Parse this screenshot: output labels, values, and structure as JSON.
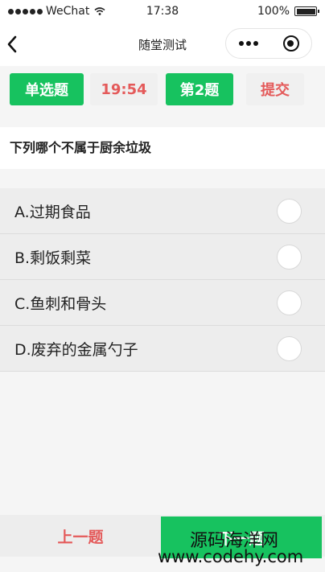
{
  "status_bar": {
    "carrier": "WeChat",
    "time": "17:38",
    "battery": "100%"
  },
  "nav": {
    "title": "随堂测试",
    "back_icon": "chevron-left-icon",
    "more_icon": "more-dots-icon",
    "close_icon": "target-icon"
  },
  "topbar": {
    "type_label": "单选题",
    "timer": "19:54",
    "question_num": "第2题",
    "submit_label": "提交"
  },
  "question": {
    "text": "下列哪个不属于厨余垃圾"
  },
  "options": [
    {
      "label": "A.过期食品"
    },
    {
      "label": "B.剩饭剩菜"
    },
    {
      "label": "C.鱼刺和骨头"
    },
    {
      "label": "D.废弃的金属勺子"
    }
  ],
  "bottom": {
    "prev_label": "上一题",
    "next_label": "下一题"
  },
  "watermark": {
    "line1": "源码海洋网",
    "line2": "www.codehy.com"
  },
  "colors": {
    "accent_green": "#17c25f",
    "accent_red": "#e45a5a"
  }
}
